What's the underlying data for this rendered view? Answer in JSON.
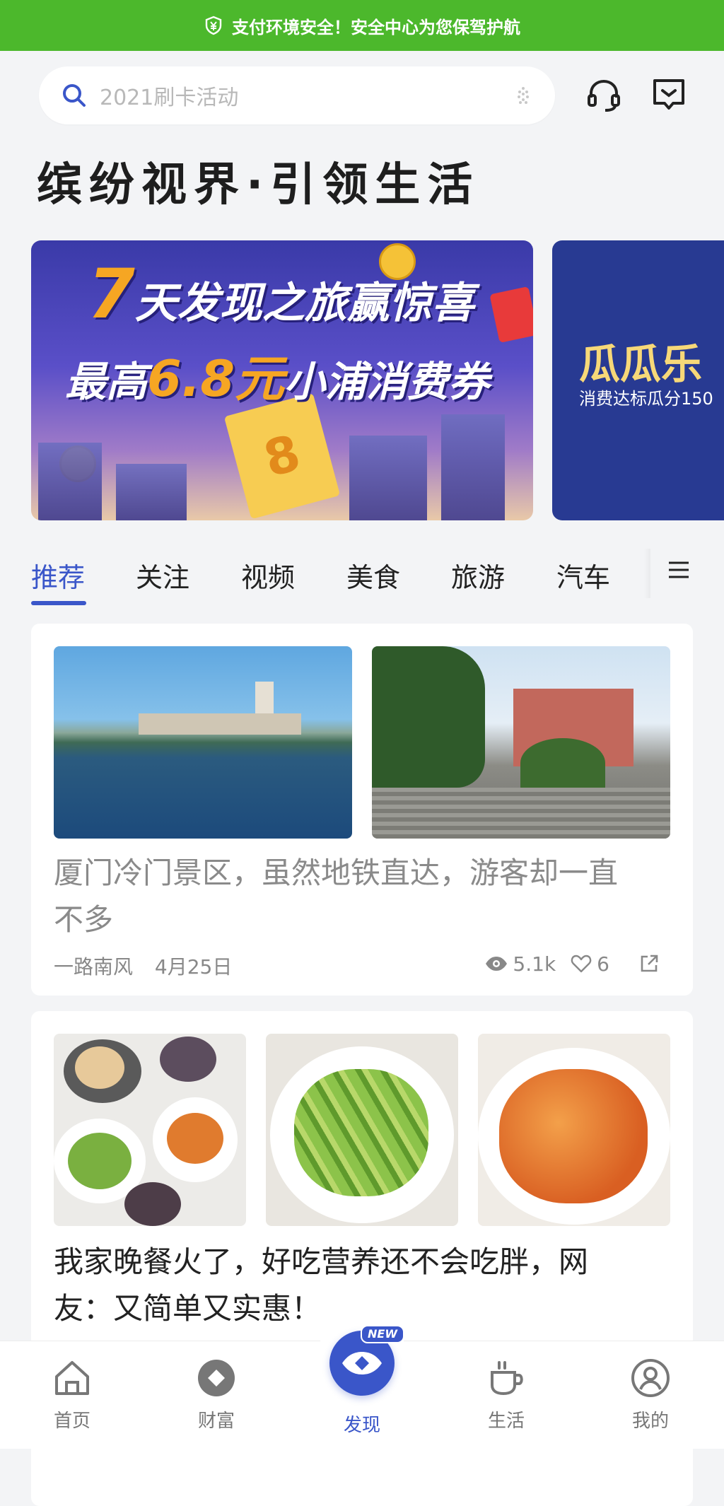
{
  "banner": {
    "text": "支付环境安全！安全中心为您保驾护航"
  },
  "search": {
    "placeholder": "2021刷卡活动"
  },
  "headline": "缤纷视界·引领生活",
  "carousel": {
    "slide1": {
      "num": "7",
      "line1_rest": "天发现之旅赢惊喜",
      "line2_pre": "最高",
      "line2_amount": "6.8元",
      "line2_post": "小浦消费券"
    },
    "slide2": {
      "title": "瓜瓜乐",
      "subtitle": "消费达标瓜分150"
    }
  },
  "tabs": [
    "推荐",
    "关注",
    "视频",
    "美食",
    "旅游",
    "汽车"
  ],
  "active_tab": "推荐",
  "articles": [
    {
      "title_line1": "厦门冷门景区，虽然地铁直达，游客却一直",
      "title_line2": "不多",
      "author": "一路南风",
      "date": "4月25日",
      "views": "5.1k",
      "likes": "6",
      "images": [
        "lake-with-buildings-image",
        "historic-building-image"
      ]
    },
    {
      "title_line1": "我家晚餐火了，好吃营养还不会吃胖，网",
      "title_line2": "友：又简单又实惠！",
      "images": [
        "dinner-spread-image",
        "stir-fried-celery-image",
        "braised-shrimp-image"
      ]
    }
  ],
  "nav": [
    {
      "label": "首页",
      "icon": "home-icon"
    },
    {
      "label": "财富",
      "icon": "wealth-icon"
    },
    {
      "label": "发现",
      "icon": "discover-eye-icon",
      "badge": "NEW",
      "active": true
    },
    {
      "label": "生活",
      "icon": "coffee-cup-icon"
    },
    {
      "label": "我的",
      "icon": "profile-icon"
    }
  ],
  "colors": {
    "accent": "#3a56c9",
    "banner_green": "#4cb82c",
    "background": "#f3f4f6"
  }
}
